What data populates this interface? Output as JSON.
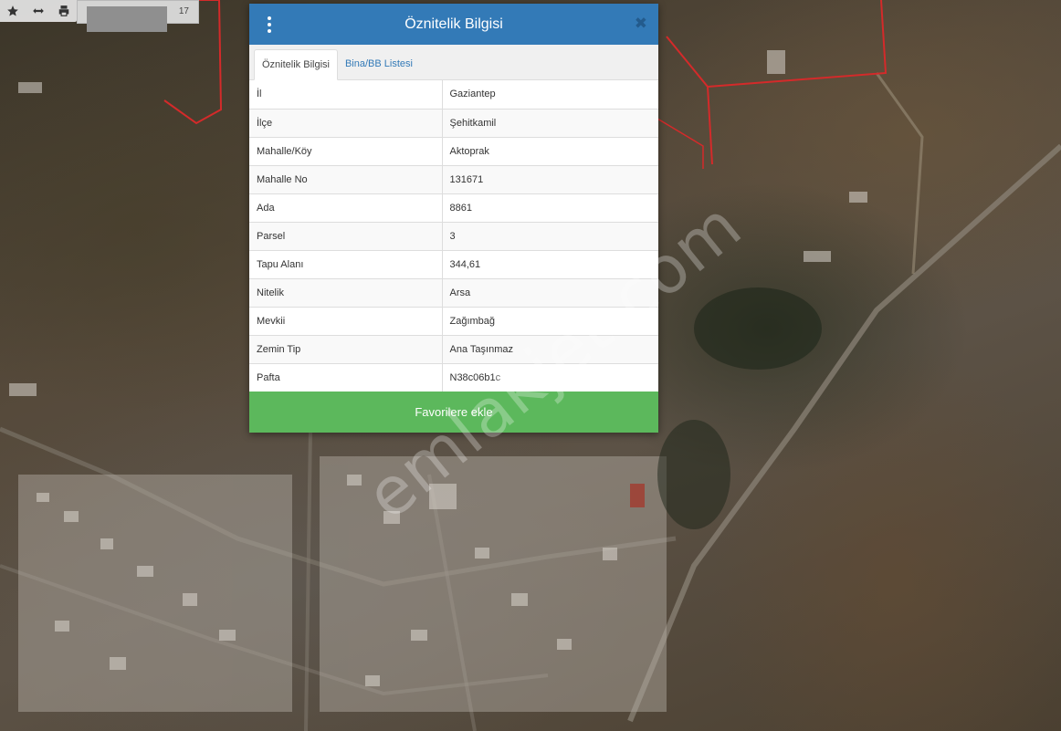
{
  "toolbar": {
    "icons": [
      "star-icon",
      "resize-horizontal-icon",
      "print-icon"
    ],
    "scale_value": "17"
  },
  "dialog": {
    "title": "Öznitelik Bilgisi",
    "menu_icon": "kebab-menu-icon",
    "close_icon": "close-icon",
    "close_label": "✖",
    "tabs": [
      {
        "label": "Öznitelik Bilgisi",
        "active": true
      },
      {
        "label": "Bina/BB Listesi",
        "active": false
      }
    ],
    "attributes": [
      {
        "key": "İl",
        "value": "Gaziantep"
      },
      {
        "key": "İlçe",
        "value": "Şehitkamil"
      },
      {
        "key": "Mahalle/Köy",
        "value": "Aktoprak"
      },
      {
        "key": "Mahalle No",
        "value": "131671"
      },
      {
        "key": "Ada",
        "value": "8861"
      },
      {
        "key": "Parsel",
        "value": "3"
      },
      {
        "key": "Tapu Alanı",
        "value": "344,61"
      },
      {
        "key": "Nitelik",
        "value": "Arsa"
      },
      {
        "key": "Mevkii",
        "value": "Zağımbağ"
      },
      {
        "key": "Zemin Tip",
        "value": "Ana Taşınmaz"
      },
      {
        "key": "Pafta",
        "value": "N38c06b1c"
      }
    ],
    "favorite_button": "Favorilere ekle"
  },
  "watermark": "emlakjet.com",
  "colors": {
    "header": "#337ab7",
    "favorite_button": "#5cb85c",
    "parcel_border": "#d42a2a"
  }
}
